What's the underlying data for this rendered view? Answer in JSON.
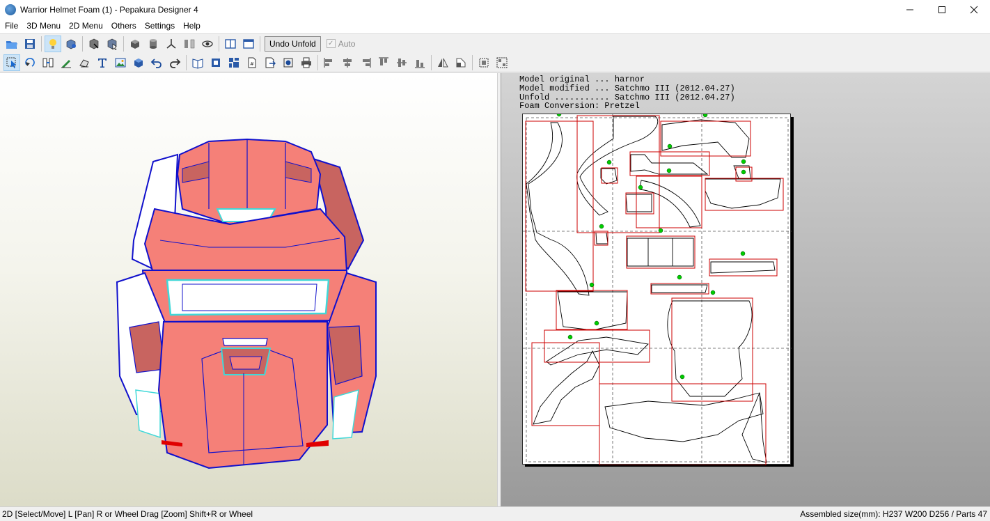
{
  "window": {
    "title": "Warrior Helmet Foam (1) - Pepakura Designer 4",
    "controls": [
      "minimize-icon",
      "maximize-icon",
      "close-icon"
    ]
  },
  "menu": [
    "File",
    "3D Menu",
    "2D Menu",
    "Others",
    "Settings",
    "Help"
  ],
  "toolbar": {
    "undo_unfold_label": "Undo Unfold",
    "auto_label": "Auto",
    "auto_checked": true,
    "row1_icons": [
      "open-icon",
      "save-icon",
      "lightbulb-icon",
      "unfold-icon",
      "edit-model-icon",
      "select-parts-icon",
      "texture-icon",
      "cylinder-icon",
      "axis-icon",
      "flaps-icon",
      "view-icon",
      "split-view-icon",
      "single-view-icon"
    ],
    "row2_icons": [
      "select-move-icon",
      "rotate-icon",
      "join-parts-icon",
      "draw-line-icon",
      "flap-tool-icon",
      "text-icon",
      "image-icon",
      "3d-part-icon",
      "undo-icon",
      "redo-icon",
      "book-icon",
      "fit-page-icon",
      "arrange-icon",
      "page-settings-icon",
      "export-icon",
      "print-preview-icon",
      "print-icon",
      "align-left-icon",
      "align-center-icon",
      "align-right-icon",
      "align-top-icon",
      "align-middle-icon",
      "align-bottom-icon",
      "flip-horizontal-icon",
      "flip-vertical-icon",
      "pack-icon",
      "unpack-icon"
    ]
  },
  "view2d": {
    "info_lines": [
      "Model original ... harnor",
      "Model modified ... Satchmo III (2012.04.27)",
      "Unfold ........... Satchmo III (2012.04.27)",
      "Foam Conversion: Pretzel"
    ]
  },
  "colors": {
    "helmet_face": "#f58078",
    "helmet_shade": "#c86460",
    "edge_blue": "#1010cc",
    "edge_cyan": "#40d8d8",
    "part_box": "#cc0000",
    "glue_marker": "#00cc00"
  },
  "status": {
    "left": "2D [Select/Move] L [Pan] R or Wheel Drag [Zoom] Shift+R or Wheel",
    "right": "Assembled size(mm): H237 W200 D256 / Parts 47"
  }
}
